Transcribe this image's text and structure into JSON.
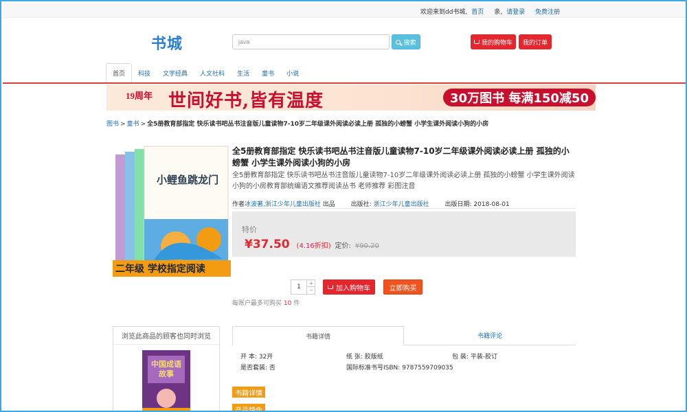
{
  "topbar": {
    "welcome": "欢迎来到dd书城,",
    "home": "首页",
    "login_prompt_prefix": "亲,",
    "login": "请登录",
    "register": "免费注册"
  },
  "header": {
    "logo": "书城",
    "search": {
      "value": "java",
      "placeholder": "java"
    },
    "search_button": "搜索",
    "cart_button": "我的购物车",
    "orders_button": "我的订单"
  },
  "nav": {
    "tabs": [
      {
        "label": "首页",
        "active": true
      },
      {
        "label": "科技"
      },
      {
        "label": "文学经典"
      },
      {
        "label": "人文社科"
      },
      {
        "label": "生活"
      },
      {
        "label": "童书"
      },
      {
        "label": "小说"
      }
    ]
  },
  "banner": {
    "anniversary": "19周年",
    "slogan": "世间好书,皆有温度",
    "deal": "30万图书 每满150减50"
  },
  "breadcrumb": {
    "items": [
      "图书",
      "童书"
    ],
    "current": "全5册教育部指定 快乐读书吧丛书注音版儿童读物7-10岁二年级课外阅读必读上册 孤独的小螃蟹 小学生课外阅读小狗的小房"
  },
  "product": {
    "cover_title": "小鲤鱼跳龙门",
    "cover_banner": "二年级 学校指定阅读",
    "title": "全5册教育部指定 快乐读书吧丛书注音版儿童读物7-10岁二年级课外阅读必读上册 孤独的小螃蟹 小学生课外阅读小狗的小房",
    "description": "全5册教育部指定 快乐读书吧丛书注音版儿童读物7-10岁二年级课外阅读必读上册 孤独的小螃蟹 小学生课外阅读小狗的小房教育部统编语文推荐阅读丛书 老师推荐 彩图注音",
    "author_label": "作者",
    "author": "冰波著,",
    "author_publisher": "浙江少年儿童出版社",
    "author_suffix": "出品",
    "publisher_label": "出版社:",
    "publisher": "浙江少年儿童出版社",
    "pubdate_label": "出版日期:",
    "pubdate": "2018-08-01",
    "price_label": "特价",
    "price": "¥37.50",
    "discount_prefix": "(",
    "discount": "4.16",
    "discount_suffix": "折扣)",
    "list_price_label": "定价:",
    "list_price": "¥90.20",
    "quantity": "1",
    "add_to_cart": "加入购物车",
    "buy_now": "立即购买",
    "limit_prefix": "每账户最多可购买",
    "limit_count": "10",
    "limit_suffix": "件"
  },
  "also_viewed": {
    "heading": "浏览此商品的顾客也同时浏览",
    "item_title": "中国成语故事"
  },
  "details": {
    "tab_info": "书籍详情",
    "tab_reviews": "书籍评论",
    "format_label": "开 本:",
    "format": "32开",
    "paper_label": "纸 张:",
    "paper": "胶版纸",
    "binding_label": "包 装:",
    "binding": "平装-胶订",
    "set_label": "是否套装:",
    "set": "否",
    "isbn_label": "国际标准书号ISBN:",
    "isbn": "9787559709035",
    "section_details": "书籍详情",
    "section_features": "产品特色"
  },
  "colors": {
    "accent_blue": "#3aa9e8",
    "link_blue": "#1a6fb5",
    "brand_red": "#e5262e",
    "buy_orange": "#f0541e",
    "tag_orange": "#f39c12",
    "search_cyan": "#5bc0de"
  }
}
